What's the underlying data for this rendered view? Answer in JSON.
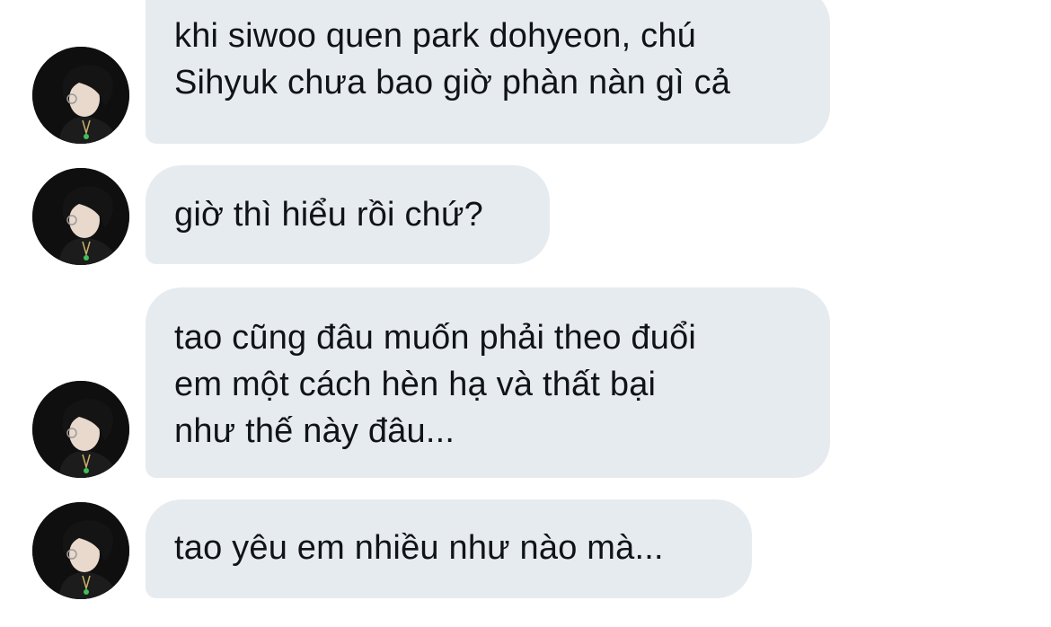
{
  "conversation": {
    "messages": [
      {
        "sender_avatar_icon": "avatar-icon",
        "text": "khi siwoo quen park dohyeon, chú\nSihyuk chưa bao giờ phàn nàn gì cả"
      },
      {
        "sender_avatar_icon": "avatar-icon",
        "text": "giờ thì hiểu rồi chứ?"
      },
      {
        "sender_avatar_icon": "avatar-icon",
        "text": "tao cũng đâu muốn phải theo đuổi\nem một cách hèn hạ và thất bại\nnhư thế này đâu..."
      },
      {
        "sender_avatar_icon": "avatar-icon",
        "text": "tao yêu em nhiều như nào mà..."
      }
    ]
  },
  "colors": {
    "background": "#ffffff",
    "bubble": "#e6ebf0",
    "text": "#111417",
    "avatar_background": "#0f0f0f",
    "avatar_accent": "#3fbf5a"
  }
}
